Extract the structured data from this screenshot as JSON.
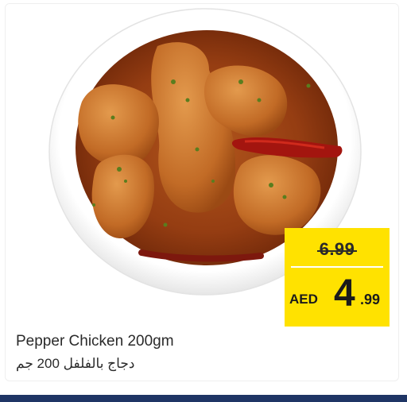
{
  "product": {
    "name_en": "Pepper Chicken 200gm",
    "name_ar": "دجاج بالفلفل 200 جم",
    "image": "pepper-chicken-curry-bowl"
  },
  "price": {
    "old": "6.99",
    "currency": "AED",
    "new_integer": "4",
    "new_decimal": ".99"
  },
  "colors": {
    "tag": "#ffe200",
    "bottom_bar": "#1f3565"
  }
}
